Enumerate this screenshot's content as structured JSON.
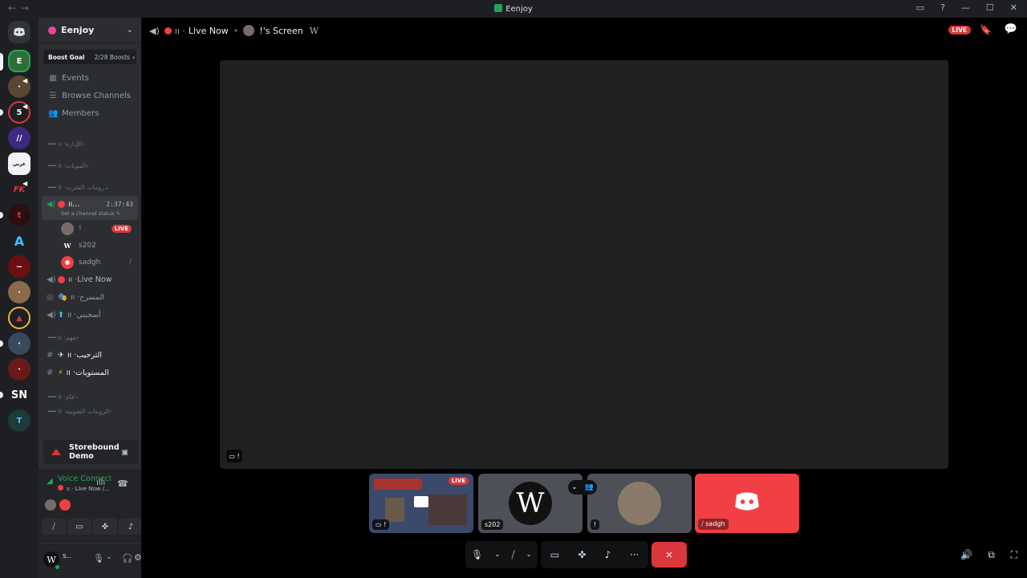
{
  "window": {
    "title": "Eenjoy"
  },
  "server": {
    "name": "Eenjoy",
    "boost_goal_label": "Boost Goal",
    "boost_count": "2/28 Boosts"
  },
  "nav": {
    "events": "Events",
    "browse_channels": "Browse Channels",
    "members": "Members"
  },
  "categories": {
    "c1": "الإدارة",
    "c2": "الموبات",
    "c3": "رومات الشرت",
    "c4": "مهم",
    "c5": "عام",
    "c6": "الرومات الصوتية"
  },
  "active_channel": {
    "name": "...",
    "timer": "2:37:43",
    "status_hint": "Set a channel status"
  },
  "voice_users": [
    {
      "name": "!",
      "live": "LIVE"
    },
    {
      "name": "s202"
    },
    {
      "name": "sadgh"
    }
  ],
  "channels": {
    "live_now": "Live Now",
    "stage1": "المسرح",
    "stage2": "أسحبني",
    "welcome": "الترحيب",
    "levels": "المستويات"
  },
  "promo": {
    "label": "Storebound Demo"
  },
  "voice_panel": {
    "status": "Voice Connecte",
    "location": "Live Now /..."
  },
  "user_panel": {
    "name": "S..."
  },
  "topbar": {
    "channel": "Live Now",
    "stream": "!'s Screen",
    "live_badge": "LIVE"
  },
  "tiles": {
    "t1_live": "LIVE",
    "t2_label": "s202",
    "t3_label": "!",
    "t4_label": "sadgh"
  },
  "colors": {
    "accent_red": "#da373c",
    "online_green": "#23a559",
    "blurple": "#5865f2"
  }
}
